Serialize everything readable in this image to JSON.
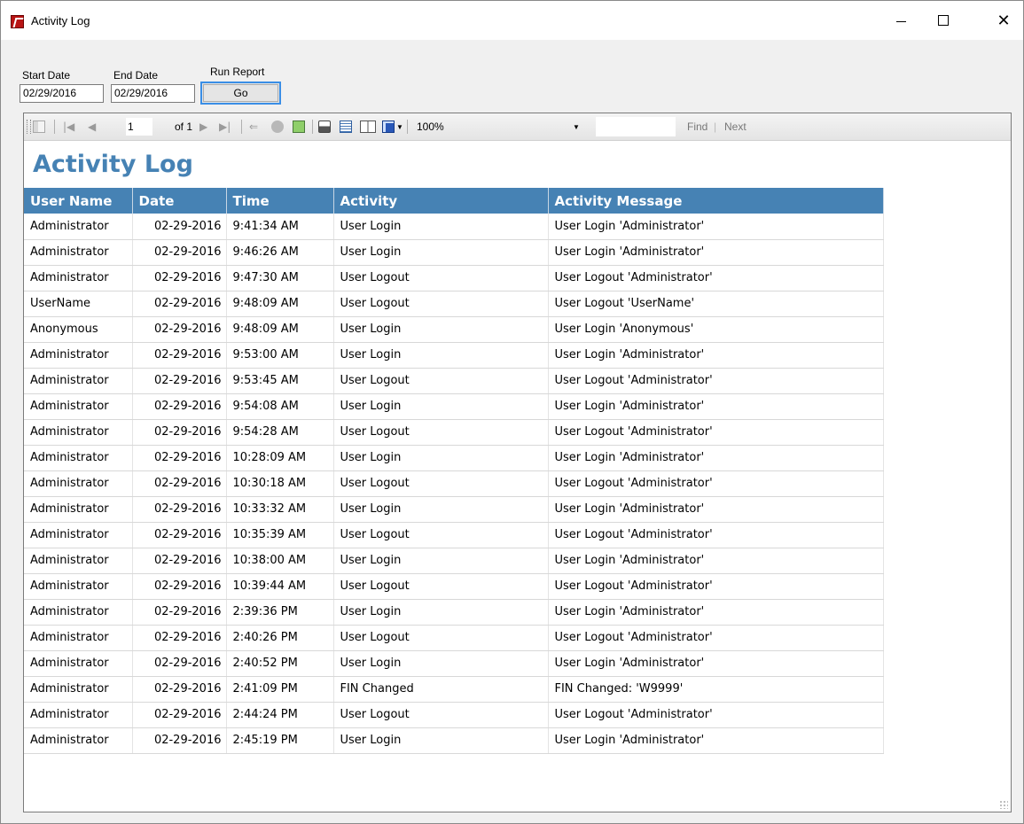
{
  "window": {
    "title": "Activity Log",
    "minimize_glyph": "",
    "close_glyph": "✕"
  },
  "params": {
    "start_label": "Start Date",
    "end_label": "End Date",
    "run_label": "Run Report",
    "start_value": "02/29/2016",
    "end_value": "02/29/2016",
    "go_label": "Go"
  },
  "toolbar": {
    "page_current": "1",
    "page_of": "of 1",
    "zoom": "100%",
    "find_label": "Find",
    "find_sep": "|",
    "next_label": "Next"
  },
  "report": {
    "title": "Activity Log",
    "columns": [
      "User Name",
      "Date",
      "Time",
      "Activity",
      "Activity Message"
    ],
    "rows": [
      [
        "Administrator",
        "02-29-2016",
        "9:41:34 AM",
        "User Login",
        "User Login 'Administrator'"
      ],
      [
        "Administrator",
        "02-29-2016",
        "9:46:26 AM",
        "User Login",
        "User Login 'Administrator'"
      ],
      [
        "Administrator",
        "02-29-2016",
        "9:47:30 AM",
        "User Logout",
        "User Logout 'Administrator'"
      ],
      [
        "UserName",
        "02-29-2016",
        "9:48:09 AM",
        "User Logout",
        "User Logout 'UserName'"
      ],
      [
        "Anonymous",
        "02-29-2016",
        "9:48:09 AM",
        "User Login",
        "User Login 'Anonymous'"
      ],
      [
        "Administrator",
        "02-29-2016",
        "9:53:00 AM",
        "User Login",
        "User Login 'Administrator'"
      ],
      [
        "Administrator",
        "02-29-2016",
        "9:53:45 AM",
        "User Logout",
        "User Logout 'Administrator'"
      ],
      [
        "Administrator",
        "02-29-2016",
        "9:54:08 AM",
        "User Login",
        "User Login 'Administrator'"
      ],
      [
        "Administrator",
        "02-29-2016",
        "9:54:28 AM",
        "User Logout",
        "User Logout 'Administrator'"
      ],
      [
        "Administrator",
        "02-29-2016",
        "10:28:09 AM",
        "User Login",
        "User Login 'Administrator'"
      ],
      [
        "Administrator",
        "02-29-2016",
        "10:30:18 AM",
        "User Logout",
        "User Logout 'Administrator'"
      ],
      [
        "Administrator",
        "02-29-2016",
        "10:33:32 AM",
        "User Login",
        "User Login 'Administrator'"
      ],
      [
        "Administrator",
        "02-29-2016",
        "10:35:39 AM",
        "User Logout",
        "User Logout 'Administrator'"
      ],
      [
        "Administrator",
        "02-29-2016",
        "10:38:00 AM",
        "User Login",
        "User Login 'Administrator'"
      ],
      [
        "Administrator",
        "02-29-2016",
        "10:39:44 AM",
        "User Logout",
        "User Logout 'Administrator'"
      ],
      [
        "Administrator",
        "02-29-2016",
        "2:39:36 PM",
        "User Login",
        "User Login 'Administrator'"
      ],
      [
        "Administrator",
        "02-29-2016",
        "2:40:26 PM",
        "User Logout",
        "User Logout 'Administrator'"
      ],
      [
        "Administrator",
        "02-29-2016",
        "2:40:52 PM",
        "User Login",
        "User Login 'Administrator'"
      ],
      [
        "Administrator",
        "02-29-2016",
        "2:41:09 PM",
        "FIN Changed",
        "FIN Changed: 'W9999'"
      ],
      [
        "Administrator",
        "02-29-2016",
        "2:44:24 PM",
        "User Logout",
        "User Logout 'Administrator'"
      ],
      [
        "Administrator",
        "02-29-2016",
        "2:45:19 PM",
        "User Login",
        "User Login 'Administrator'"
      ]
    ]
  },
  "colors": {
    "header_bg": "#4682b4",
    "title_color": "#4682b4",
    "focus_border": "#3a8ee6"
  }
}
